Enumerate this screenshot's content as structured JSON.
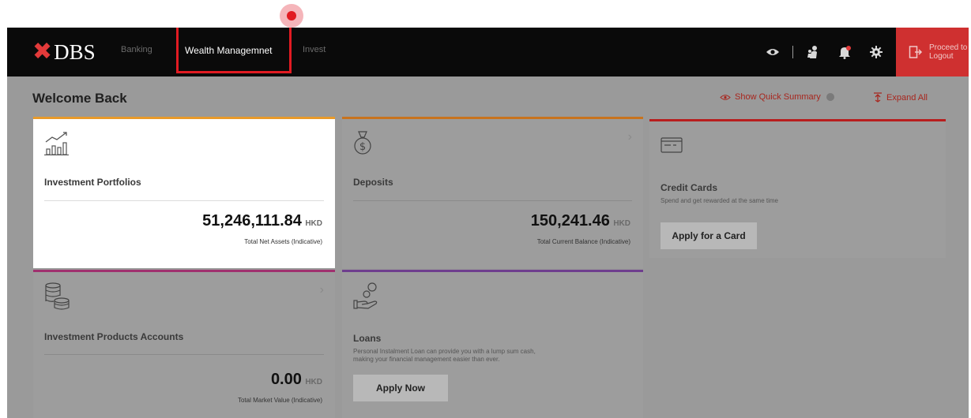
{
  "header": {
    "logo_mark": "✖",
    "logo_text": "DBS",
    "nav": [
      "Banking",
      "Wealth Managemnet",
      "Invest"
    ],
    "logout_lines": [
      "Proceed to",
      "Logout"
    ],
    "icons": [
      "eye-icon",
      "people-icon",
      "bell-icon",
      "gear-icon",
      "logout-icon"
    ]
  },
  "main": {
    "title": "Welcome Back",
    "show_quick_summary": "Show Quick Summary",
    "expand_all": "Expand All"
  },
  "cards": {
    "investment": {
      "title": "Investment Portfolios",
      "amount": "51,246,111.84",
      "currency": "HKD",
      "label": "Total Net Assets (Indicative)",
      "accent": "#e89a2a"
    },
    "deposits": {
      "title": "Deposits",
      "amount": "150,241.46",
      "currency": "HKD",
      "label": "Total Current Balance (Indicative)",
      "accent": "#c8731e"
    },
    "credit": {
      "title": "Credit Cards",
      "desc": "Spend and get rewarded at the same time",
      "button": "Apply for a Card",
      "accent": "#b81e1e"
    },
    "products": {
      "title": "Investment Products Accounts",
      "amount": "0.00",
      "currency": "HKD",
      "label": "Total Market Value (Indicative)",
      "accent": "#a0306e"
    },
    "loans": {
      "title": "Loans",
      "desc_line1": "Personal Instalment Loan can provide you with a lump sum cash,",
      "desc_line2": "making your financial management easier than ever.",
      "button": "Apply Now",
      "accent": "#6e3e8e"
    }
  }
}
